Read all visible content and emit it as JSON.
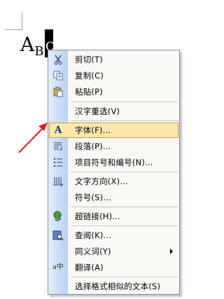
{
  "document": {
    "text_main": "A",
    "text_sub": "B",
    "text_selected": "C"
  },
  "context_menu": {
    "items": [
      {
        "label": "剪切(T)",
        "icon": "scissors-icon"
      },
      {
        "label": "复制(C)",
        "icon": "copy-icon"
      },
      {
        "label": "粘贴(P)",
        "icon": "paste-icon"
      },
      {
        "label": "汉字重选(V)",
        "icon": ""
      },
      {
        "label": "字体(F)...",
        "icon": "font-icon",
        "highlighted": true
      },
      {
        "label": "段落(P)...",
        "icon": "paragraph-icon"
      },
      {
        "label": "项目符号和编号(N)...",
        "icon": "bullets-icon"
      },
      {
        "label": "文字方向(X)...",
        "icon": "text-direction-icon"
      },
      {
        "label": "符号(S)...",
        "icon": ""
      },
      {
        "label": "超链接(H)...",
        "icon": "hyperlink-icon"
      },
      {
        "label": "查阅(K)...",
        "icon": "research-icon"
      },
      {
        "label": "同义词(Y)",
        "icon": "",
        "submenu": true
      },
      {
        "label": "翻译(A)",
        "icon": "translate-icon"
      },
      {
        "label": "选择格式相似的文本(S)",
        "icon": ""
      }
    ]
  },
  "colors": {
    "highlight_fill": "#fbe8ad",
    "highlight_border": "#c59f3e",
    "annotation_arrow": "#e02020"
  }
}
